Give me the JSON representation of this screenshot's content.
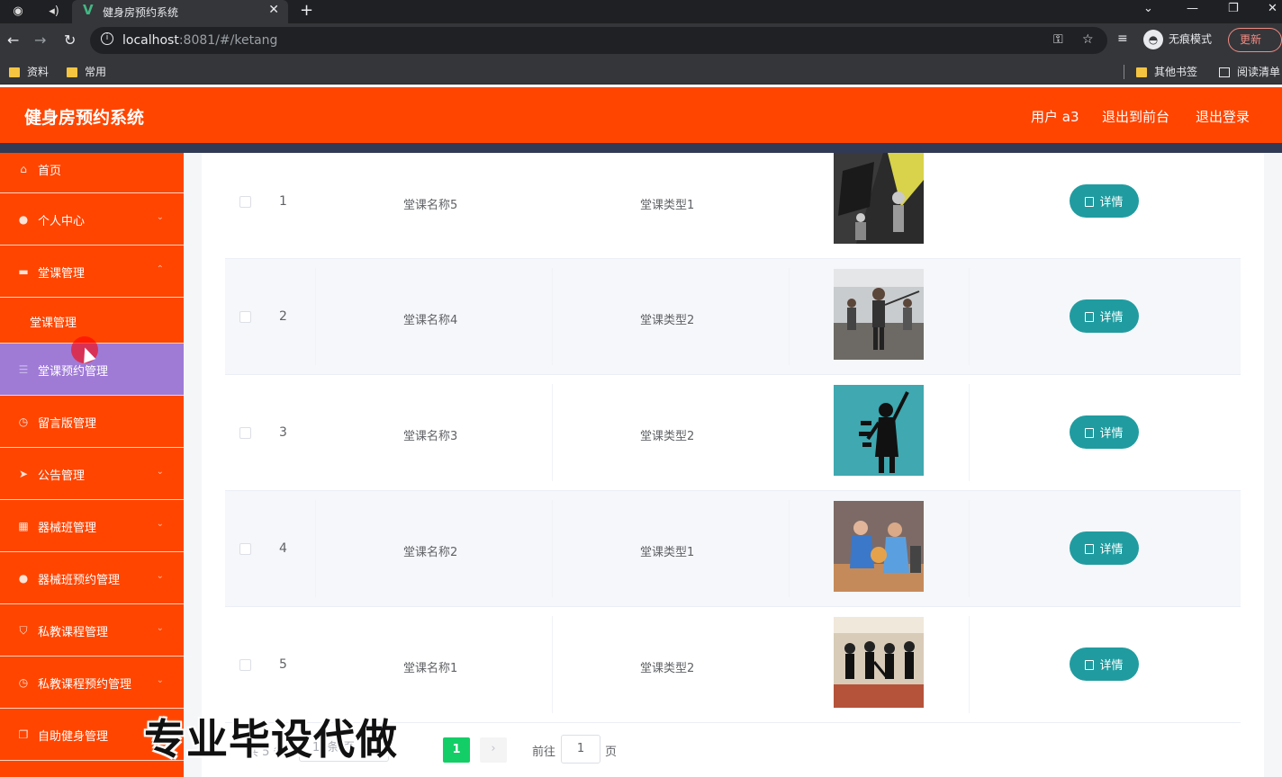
{
  "browser": {
    "tab_title": "健身房预约系统",
    "url_host": "localhost",
    "url_rest": ":8081/#/ketang",
    "incognito_label": "无痕模式",
    "update_label": "更新",
    "bookmarks": [
      "资料",
      "常用"
    ],
    "bookmarks_right": [
      "其他书签",
      "阅读清单"
    ]
  },
  "header": {
    "title": "健身房预约系统",
    "user_label": "用户 a3",
    "to_front_label": "退出到前台",
    "logout_label": "退出登录"
  },
  "sidebar": {
    "items": [
      {
        "label": "首页",
        "icon": "home-icon"
      },
      {
        "label": "个人中心",
        "icon": "user-icon"
      },
      {
        "label": "堂课管理",
        "icon": "briefcase-icon"
      },
      {
        "label": "堂课管理",
        "icon": ""
      },
      {
        "label": "堂课预约管理",
        "icon": "list-icon"
      },
      {
        "label": "留言版管理",
        "icon": "clock-icon"
      },
      {
        "label": "公告管理",
        "icon": "send-icon"
      },
      {
        "label": "器械班管理",
        "icon": "grid-icon"
      },
      {
        "label": "器械班预约管理",
        "icon": "user-icon"
      },
      {
        "label": "私教课程管理",
        "icon": "shield-icon"
      },
      {
        "label": "私教课程预约管理",
        "icon": "clock-icon"
      },
      {
        "label": "自助健身管理",
        "icon": "copy-icon"
      }
    ]
  },
  "table": {
    "detail_label": "详情",
    "rows": [
      {
        "index": "1",
        "name": "堂课名称5",
        "type": "堂课类型1"
      },
      {
        "index": "2",
        "name": "堂课名称4",
        "type": "堂课类型2"
      },
      {
        "index": "3",
        "name": "堂课名称3",
        "type": "堂课类型2"
      },
      {
        "index": "4",
        "name": "堂课名称2",
        "type": "堂课类型1"
      },
      {
        "index": "5",
        "name": "堂课名称1",
        "type": "堂课类型2"
      }
    ]
  },
  "pagination": {
    "total": "共 5 条",
    "page_size": "10条/页",
    "current_page": "1",
    "goto_label": "前往",
    "goto_value": "1",
    "page_label": "页"
  },
  "watermark": "专业毕设代做",
  "colors": {
    "header": "#ff4500",
    "active_menu": "#9f7bd6",
    "detail_button": "#209ca0",
    "current_page": "#13ce66"
  }
}
